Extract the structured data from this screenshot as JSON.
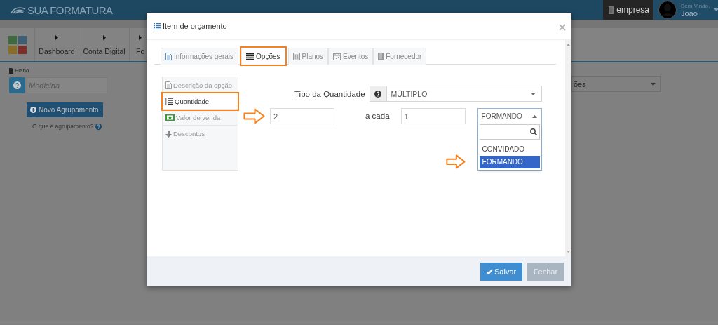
{
  "header": {
    "logo": "SUA FORMATURA",
    "company_button": "empresa",
    "greeting": "Bem Vindo,",
    "user": "João"
  },
  "nav": {
    "items": [
      {
        "label": "Dashboard"
      },
      {
        "label": "Conta Digital"
      },
      {
        "label": "Fo"
      }
    ]
  },
  "plan": {
    "label": "Plano",
    "placeholder": "Medicina",
    "new_group_button": "Novo Agrupamento",
    "help_link": "O que é agrupamento?"
  },
  "right_select": {
    "value": "ões"
  },
  "modal": {
    "title": "Item de orçamento",
    "tabs": [
      {
        "label": "Informações gerais",
        "selected": false,
        "highlighted": false
      },
      {
        "label": "Opções",
        "selected": true,
        "highlighted": true
      },
      {
        "label": "Planos",
        "selected": false,
        "highlighted": false
      },
      {
        "label": "Eventos",
        "selected": false,
        "highlighted": false
      },
      {
        "label": "Fornecedor",
        "selected": false,
        "highlighted": false
      }
    ],
    "side_menu": [
      {
        "label": "Descrição da opção",
        "selected": false,
        "highlighted": false
      },
      {
        "label": "Quantidade",
        "selected": true,
        "highlighted": true
      },
      {
        "label": "Valor de venda",
        "selected": false,
        "highlighted": false
      },
      {
        "label": "Descontos",
        "selected": false,
        "highlighted": false
      }
    ],
    "quantity_type": {
      "label": "Tipo da Quantidade",
      "value": "MÚLTIPLO"
    },
    "amount": {
      "value": "2",
      "pointed": true
    },
    "per_label": "a cada",
    "per_value": "1",
    "unit_dropdown": {
      "value": "FORMANDO",
      "expanded": true,
      "options": [
        {
          "label": "CONVIDADO",
          "selected": false,
          "pointed": false
        },
        {
          "label": "FORMANDO",
          "selected": true,
          "pointed": true
        }
      ]
    },
    "buttons": [
      {
        "label": "Salvar",
        "kind": "primary"
      },
      {
        "label": "Fechar",
        "kind": "secondary"
      }
    ]
  }
}
